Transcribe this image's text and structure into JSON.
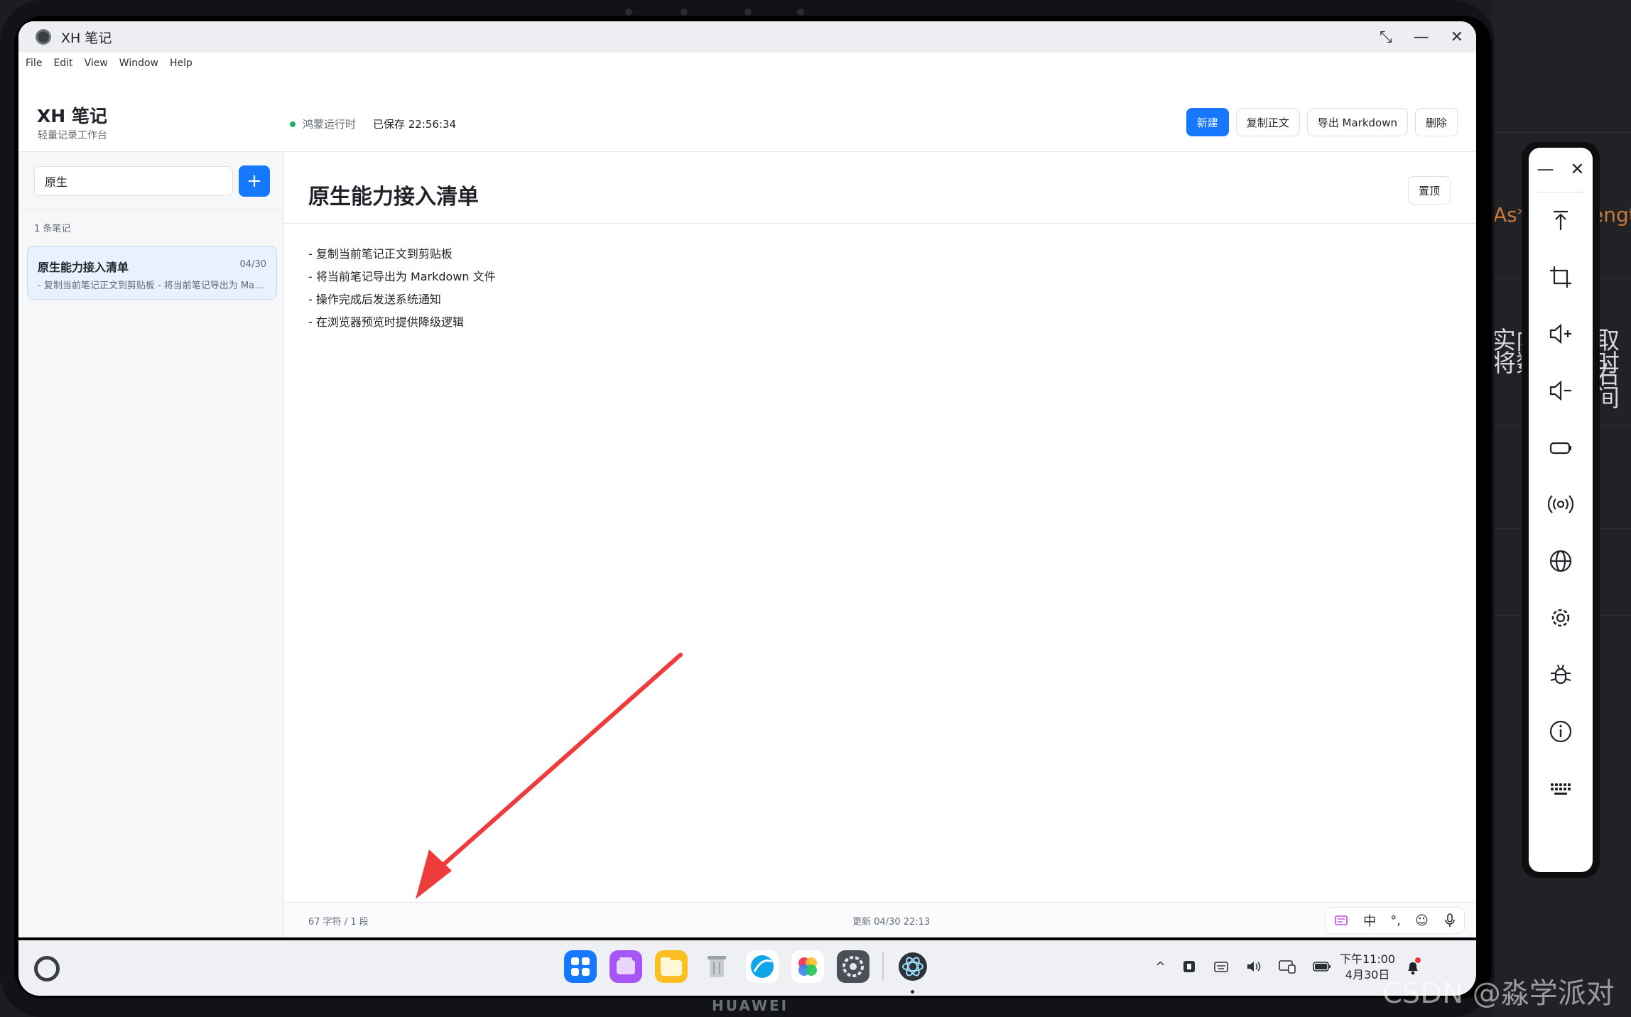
{
  "window": {
    "title": "XH 笔记"
  },
  "menu": [
    "File",
    "Edit",
    "View",
    "Window",
    "Help"
  ],
  "header": {
    "app_name": "XH 笔记",
    "app_subtitle": "轻量记录工作台",
    "runtime_status": "鸿蒙运行时",
    "saved_text": "已保存 22:56:34",
    "buttons": {
      "new": "新建",
      "copy": "复制正文",
      "export": "导出 Markdown",
      "delete": "删除"
    }
  },
  "sidebar": {
    "search_value": "原生",
    "add_label": "+",
    "count_text": "1 条笔记",
    "notes": [
      {
        "title": "原生能力接入清单",
        "date": "04/30",
        "snippet": "- 复制当前笔记正文到剪贴板 - 将当前笔记导出为 Markdown 文件"
      }
    ]
  },
  "editor": {
    "title": "原生能力接入清单",
    "pin_label": "置顶",
    "body": [
      "- 复制当前笔记正文到剪贴板",
      "- 将当前笔记导出为 Markdown 文件",
      "- 操作完成后发送系统通知",
      "- 在浏览器预览时提供降级逻辑"
    ],
    "footer_count": "67 字符 / 1 段",
    "footer_updated": "更新 04/30 22:13",
    "ime": {
      "lang": "中",
      "punct": "°,",
      "emoji": "☺",
      "mic": "mic-icon"
    }
  },
  "taskbar": {
    "clock_time": "下午11:00",
    "clock_date": "4月30日",
    "tray_caret": "^"
  },
  "device": {
    "brand": "HUAWEI"
  },
  "watermark": "CSDN @淼学派对",
  "backdrop": {
    "line1": "As*",
    "line2": "engt",
    "t1": "实内",
    "t2": "取右",
    "t3": "将数",
    "t4": "时间"
  },
  "colors": {
    "primary": "#1677ff",
    "status_green": "#19b46a",
    "arrow_red": "#ee3b3b"
  }
}
